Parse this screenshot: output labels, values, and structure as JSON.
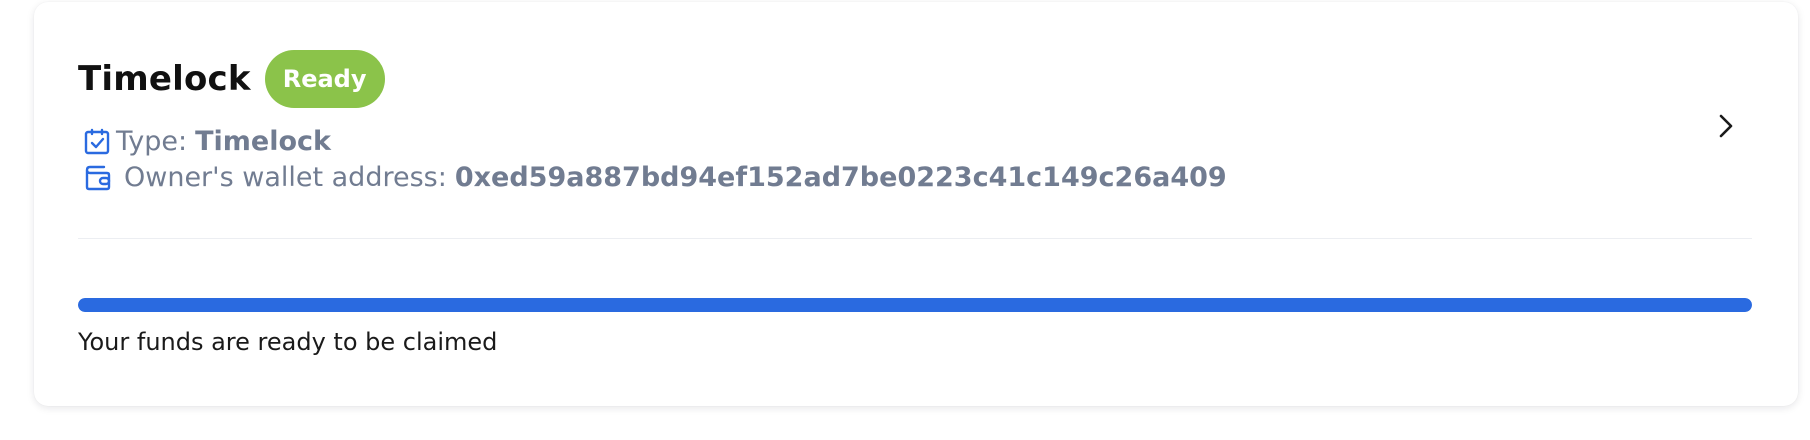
{
  "card": {
    "title": "Timelock",
    "badge": "Ready",
    "type_label": "Type:",
    "type_value": "Timelock",
    "owner_label": "Owner's wallet address:",
    "owner_value": "0xed59a887bd94ef152ad7be0223c41c149c26a409",
    "status_text": "Your funds are ready to be claimed",
    "progress_fraction": 1.0,
    "icons": {
      "type": "calendar-check-icon",
      "owner": "wallet-icon",
      "open": "chevron-right-icon"
    },
    "colors": {
      "badge": "#8bc34a",
      "progress": "#2a6ae0",
      "icon": "#2a6ae0",
      "meta_text": "#717c91"
    }
  }
}
